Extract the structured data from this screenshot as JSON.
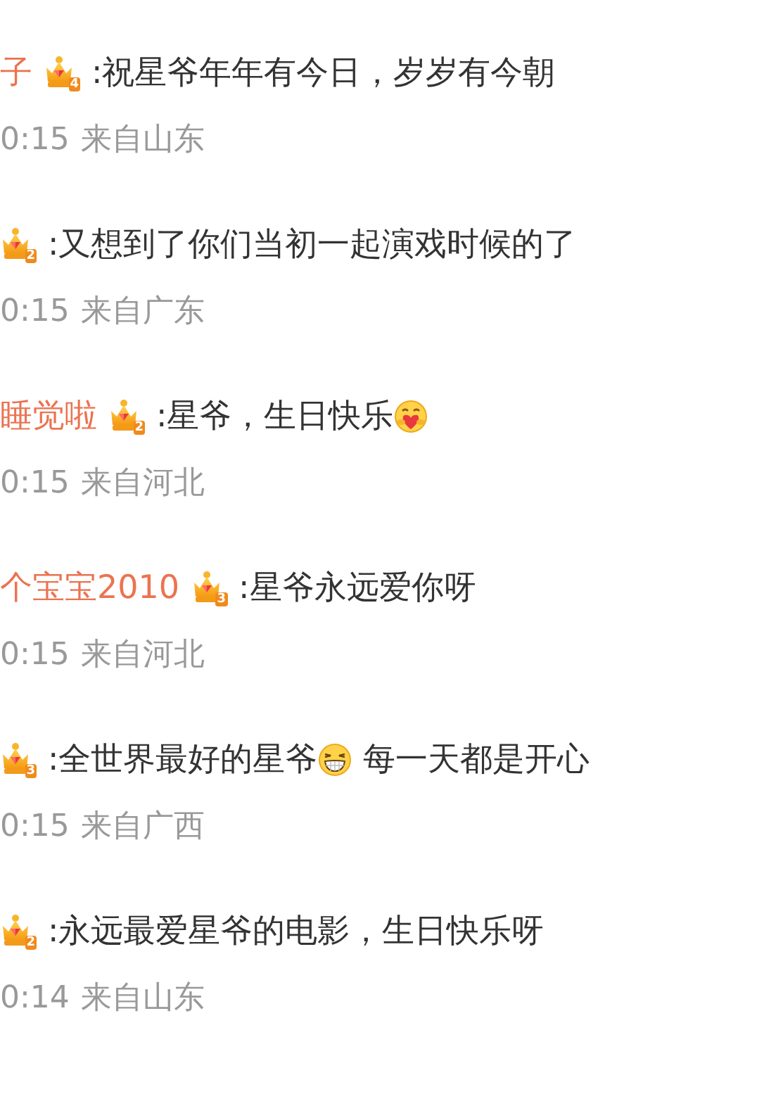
{
  "comments": [
    {
      "user": "子",
      "badge_level": "4",
      "parts": [
        {
          "kind": "text",
          "text": ":祝星爷年年有今日，岁岁有今朝"
        }
      ],
      "time": "0:15",
      "location": "来自山东"
    },
    {
      "badge_level": "2",
      "parts": [
        {
          "kind": "text",
          "text": ":又想到了你们当初一起演戏时候的了"
        }
      ],
      "time": "0:15",
      "location": "来自广东"
    },
    {
      "user": "睡觉啦",
      "badge_level": "2",
      "parts": [
        {
          "kind": "text",
          "text": ":星爷，生日快乐"
        },
        {
          "kind": "hug"
        }
      ],
      "time": "0:15",
      "location": "来自河北"
    },
    {
      "user": "个宝宝2010",
      "badge_level": "3",
      "parts": [
        {
          "kind": "text",
          "text": ":星爷永远爱你呀"
        }
      ],
      "time": "0:15",
      "location": "来自河北"
    },
    {
      "badge_level": "3",
      "parts": [
        {
          "kind": "text",
          "text": ":全世界最好的星爷"
        },
        {
          "kind": "grin"
        },
        {
          "kind": "text",
          "text": "每一天都是开心"
        }
      ],
      "time": "0:15",
      "location": "来自广西"
    },
    {
      "badge_level": "2",
      "parts": [
        {
          "kind": "text",
          "text": ":永远最爱星爷的电影，生日快乐呀"
        }
      ],
      "time": "0:14",
      "location": "来自山东"
    }
  ]
}
